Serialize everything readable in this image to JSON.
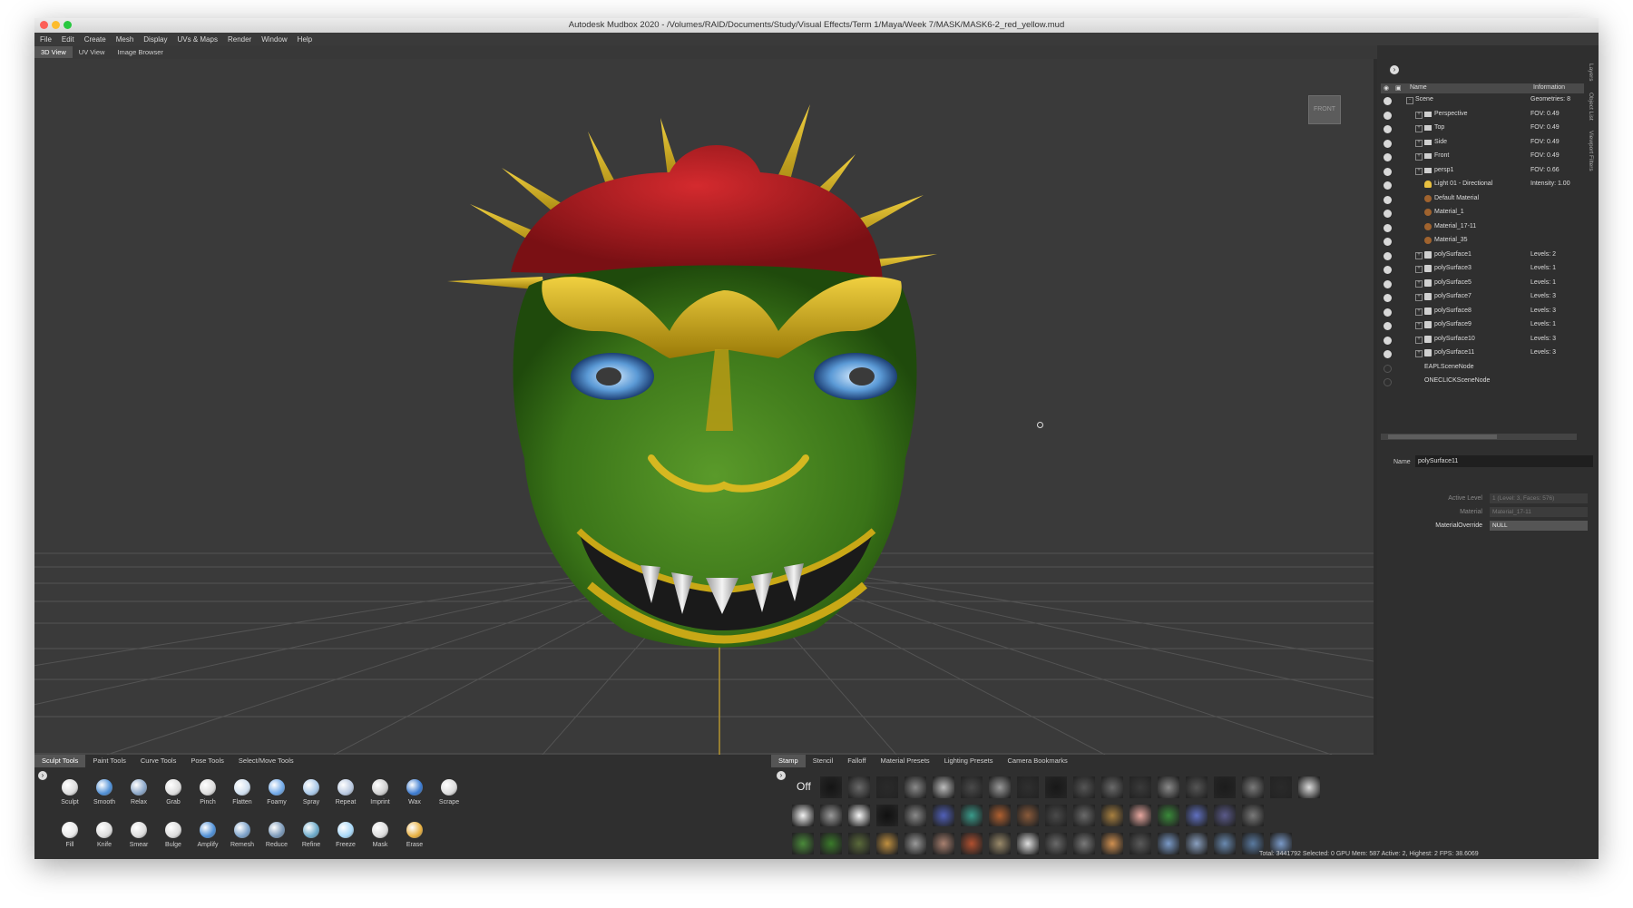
{
  "window": {
    "title": "Autodesk Mudbox 2020 - /Volumes/RAID/Documents/Study/Visual Effects/Term 1/Maya/Week 7/MASK/MASK6-2_red_yellow.mud"
  },
  "menu": [
    "File",
    "Edit",
    "Create",
    "Mesh",
    "Display",
    "UVs & Maps",
    "Render",
    "Window",
    "Help"
  ],
  "view_tabs": [
    "3D View",
    "UV View",
    "Image Browser"
  ],
  "viewport": {
    "view_cube_label": "FRONT"
  },
  "side_tabs": [
    "Layers",
    "Object List",
    "Viewport Filters"
  ],
  "object_list": {
    "header_name": "Name",
    "header_info": "Information",
    "rows": [
      {
        "name": "Scene",
        "info": "Geometries: 8",
        "indent": 0,
        "icon": "none",
        "expand": "-"
      },
      {
        "name": "Perspective",
        "info": "FOV: 0.49",
        "indent": 1,
        "icon": "camera",
        "expand": "+"
      },
      {
        "name": "Top",
        "info": "FOV: 0.49",
        "indent": 1,
        "icon": "camera",
        "expand": "+"
      },
      {
        "name": "Side",
        "info": "FOV: 0.49",
        "indent": 1,
        "icon": "camera",
        "expand": "+"
      },
      {
        "name": "Front",
        "info": "FOV: 0.49",
        "indent": 1,
        "icon": "camera",
        "expand": "+"
      },
      {
        "name": "persp1",
        "info": "FOV: 0.66",
        "indent": 1,
        "icon": "camera",
        "expand": "+"
      },
      {
        "name": "Light 01 - Directional",
        "info": "Intensity: 1.00",
        "indent": 1,
        "icon": "light",
        "expand": ""
      },
      {
        "name": "Default Material",
        "info": "",
        "indent": 1,
        "icon": "material",
        "expand": ""
      },
      {
        "name": "Material_1",
        "info": "",
        "indent": 1,
        "icon": "material",
        "expand": ""
      },
      {
        "name": "Material_17-11",
        "info": "",
        "indent": 1,
        "icon": "material",
        "expand": ""
      },
      {
        "name": "Material_35",
        "info": "",
        "indent": 1,
        "icon": "material",
        "expand": ""
      },
      {
        "name": "polySurface1",
        "info": "Levels: 2",
        "indent": 1,
        "icon": "mesh",
        "expand": "+"
      },
      {
        "name": "polySurface3",
        "info": "Levels: 1",
        "indent": 1,
        "icon": "mesh",
        "expand": "+"
      },
      {
        "name": "polySurface5",
        "info": "Levels: 1",
        "indent": 1,
        "icon": "mesh",
        "expand": "+"
      },
      {
        "name": "polySurface7",
        "info": "Levels: 3",
        "indent": 1,
        "icon": "mesh",
        "expand": "+"
      },
      {
        "name": "polySurface8",
        "info": "Levels: 3",
        "indent": 1,
        "icon": "mesh",
        "expand": "+"
      },
      {
        "name": "polySurface9",
        "info": "Levels: 1",
        "indent": 1,
        "icon": "mesh",
        "expand": "+"
      },
      {
        "name": "polySurface10",
        "info": "Levels: 3",
        "indent": 1,
        "icon": "mesh",
        "expand": "+"
      },
      {
        "name": "polySurface11",
        "info": "Levels: 3",
        "indent": 1,
        "icon": "mesh",
        "expand": "+"
      },
      {
        "name": "EAPLSceneNode",
        "info": "",
        "indent": 1,
        "icon": "none",
        "expand": "",
        "off": true
      },
      {
        "name": "ONECLICKSceneNode",
        "info": "",
        "indent": 1,
        "icon": "none",
        "expand": "",
        "off": true
      }
    ]
  },
  "properties": {
    "name_label": "Name",
    "name_value": "polySurface11",
    "active_level_label": "Active Level",
    "active_level_value": "1 (Level: 3, Faces: 576)",
    "material_label": "Material",
    "material_value": "Material_17-11",
    "override_label": "MaterialOverride",
    "override_value": "NULL"
  },
  "tool_tabs": [
    "Sculpt Tools",
    "Paint Tools",
    "Curve Tools",
    "Pose Tools",
    "Select/Move Tools"
  ],
  "sculpt_tools_row1": [
    "Sculpt",
    "Smooth",
    "Relax",
    "Grab",
    "Pinch",
    "Flatten",
    "Foamy",
    "Spray",
    "Repeat",
    "Imprint",
    "Wax",
    "Scrape"
  ],
  "sculpt_tools_row2": [
    "Fill",
    "Knife",
    "Smear",
    "Bulge",
    "Amplify",
    "Remesh",
    "Reduce",
    "Refine",
    "Freeze",
    "Mask",
    "Erase"
  ],
  "stamp_tabs": [
    "Stamp",
    "Stencil",
    "Falloff",
    "Material Presets",
    "Lighting Presets",
    "Camera Bookmarks"
  ],
  "stamp_off_label": "Off",
  "status": "Total: 3441792  Selected: 0 GPU Mem: 587  Active: 2, Highest: 2  FPS: 38.6069",
  "colors": {
    "mask_red": "#b0181f",
    "mask_green": "#3f7d1c",
    "mask_gold": "#c9a816",
    "eye_blue": "#4f8fcc",
    "viewport_bg": "#3a3a3a"
  }
}
